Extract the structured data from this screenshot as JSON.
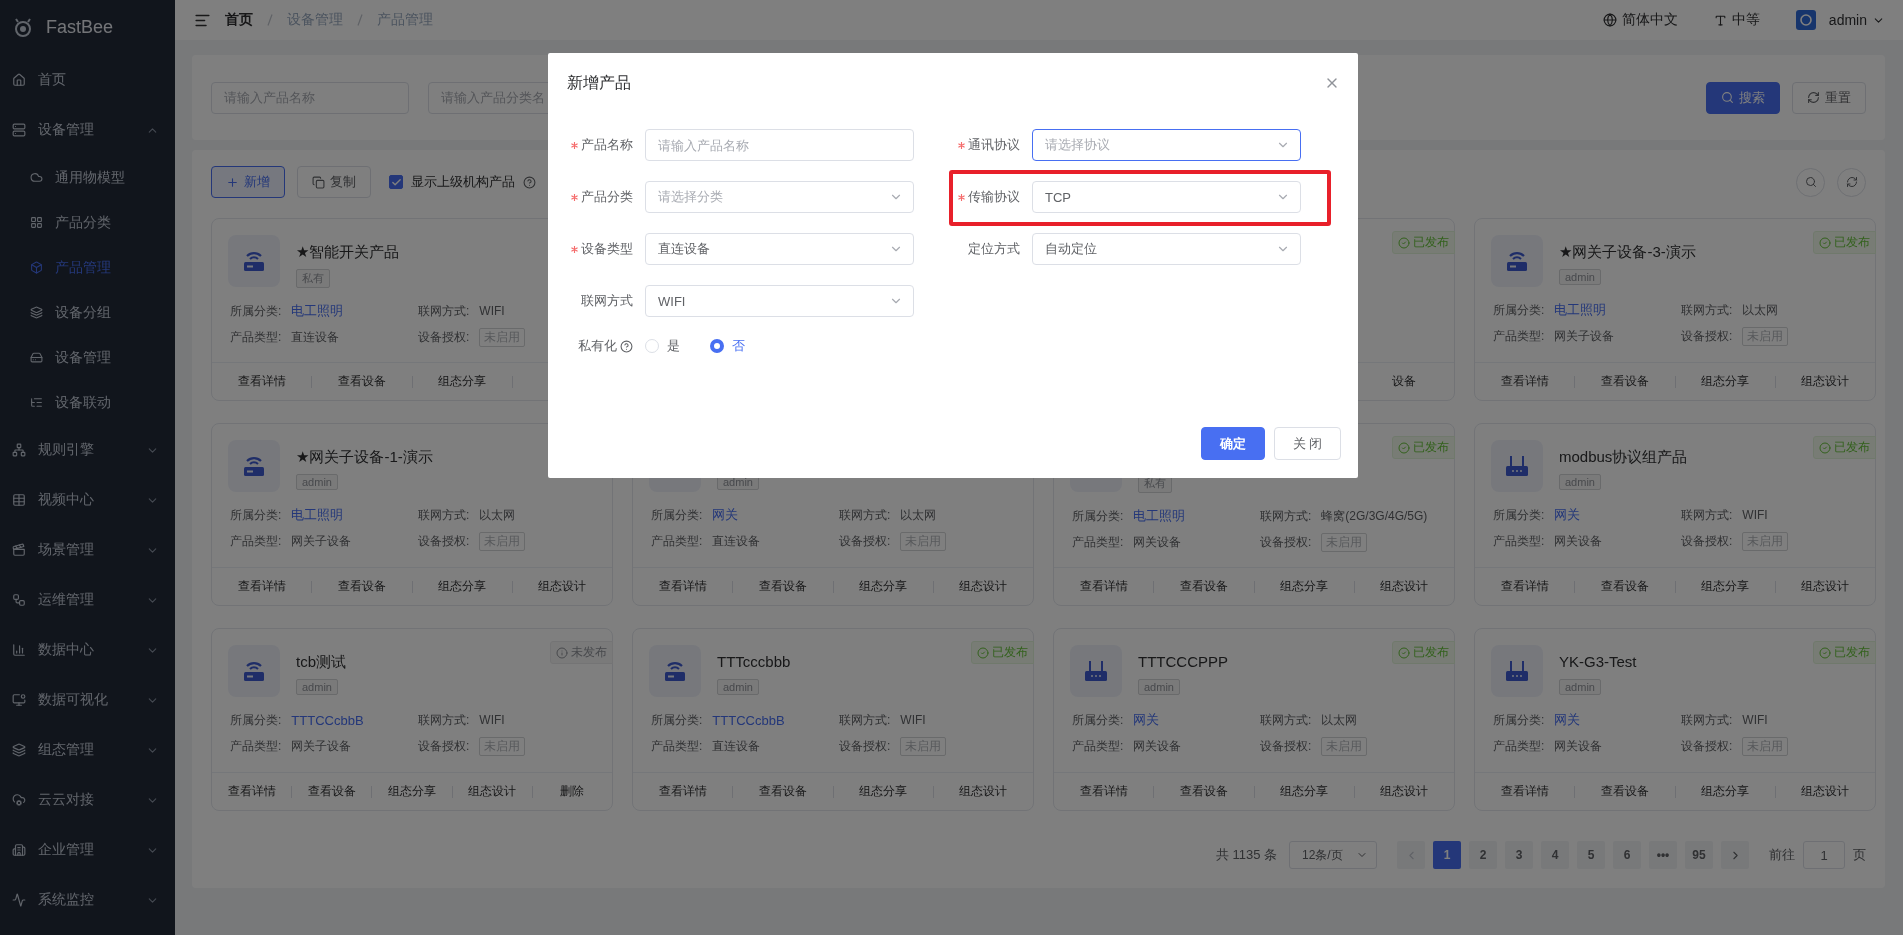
{
  "sidebar": {
    "brand": "FastBee",
    "items": [
      {
        "label": "首页",
        "selected": false
      },
      {
        "label": "设备管理",
        "selected": false,
        "expanded": true,
        "children": [
          {
            "label": "通用物模型",
            "selected": false
          },
          {
            "label": "产品分类",
            "selected": false
          },
          {
            "label": "产品管理",
            "selected": true
          },
          {
            "label": "设备分组",
            "selected": false
          },
          {
            "label": "设备管理",
            "selected": false
          },
          {
            "label": "设备联动",
            "selected": false
          }
        ]
      },
      {
        "label": "规则引擎",
        "selected": false,
        "expanded": false
      },
      {
        "label": "视频中心",
        "selected": false,
        "expanded": false
      },
      {
        "label": "场景管理",
        "selected": false,
        "expanded": false
      },
      {
        "label": "运维管理",
        "selected": false,
        "expanded": false
      },
      {
        "label": "数据中心",
        "selected": false,
        "expanded": false
      },
      {
        "label": "数据可视化",
        "selected": false,
        "expanded": false
      },
      {
        "label": "组态管理",
        "selected": false,
        "expanded": false
      },
      {
        "label": "云云对接",
        "selected": false,
        "expanded": false
      },
      {
        "label": "企业管理",
        "selected": false,
        "expanded": false
      },
      {
        "label": "系统监控",
        "selected": false,
        "expanded": false
      }
    ]
  },
  "header": {
    "breadcrumb": [
      {
        "label": "首页",
        "link": true
      },
      {
        "label": "设备管理",
        "link": false
      },
      {
        "label": "产品管理",
        "link": false
      }
    ],
    "language": "简体中文",
    "size": "中等",
    "user": "admin"
  },
  "filter": {
    "fields": [
      {
        "placeholder": "请输入产品名称"
      },
      {
        "placeholder": "请输入产品分类名"
      }
    ],
    "buttons": [
      {
        "label": "搜索",
        "kind": "primary"
      },
      {
        "label": "重置",
        "kind": "default"
      }
    ]
  },
  "toolbar": {
    "buttons": [
      {
        "label": "新增",
        "kind": "plain"
      },
      {
        "label": "复制",
        "kind": "default"
      }
    ],
    "checkbox": {
      "label": "显示上级机构产品",
      "checked": true
    }
  },
  "cards": [
    {
      "kind": "router",
      "name": "★智能开关产品",
      "tag": "私有",
      "fields": [
        {
          "label": "所属分类:",
          "value": "电工照明",
          "kind": "link"
        },
        {
          "label": "联网方式:",
          "value": "WIFI",
          "kind": "text"
        },
        {
          "label": "产品类型:",
          "value": "直连设备",
          "kind": "text"
        },
        {
          "label": "设备授权:",
          "value": "未启用",
          "kind": "tag"
        }
      ],
      "actions": [
        "查看详情",
        "查看设备",
        "组态分享"
      ]
    },
    {
      "status": {
        "label": "已发布",
        "published": true
      },
      "actions": [
        "设备"
      ]
    },
    {
      "kind": "router",
      "name": "★网关子设备-3-演示",
      "tag": "admin",
      "status": {
        "label": "已发布",
        "published": true
      },
      "fields": [
        {
          "label": "所属分类:",
          "value": "电工照明",
          "kind": "link"
        },
        {
          "label": "联网方式:",
          "value": "以太网",
          "kind": "text"
        },
        {
          "label": "产品类型:",
          "value": "网关子设备",
          "kind": "text"
        },
        {
          "label": "设备授权:",
          "value": "未启用",
          "kind": "tag"
        }
      ],
      "actions": [
        "查看详情",
        "查看设备",
        "组态分享",
        "组态设计"
      ]
    },
    {
      "kind": "router",
      "name": "★网关子设备-1-演示",
      "tag": "admin",
      "fields": [
        {
          "label": "所属分类:",
          "value": "电工照明",
          "kind": "link"
        },
        {
          "label": "联网方式:",
          "value": "以太网",
          "kind": "text"
        },
        {
          "label": "产品类型:",
          "value": "网关子设备",
          "kind": "text"
        },
        {
          "label": "设备授权:",
          "value": "未启用",
          "kind": "tag"
        }
      ],
      "actions": [
        "查看详情",
        "查看设备",
        "组态分享",
        "组态设计"
      ]
    },
    {
      "tag": "admin",
      "fields": [
        {
          "label": "所属分类:",
          "value": "网关",
          "kind": "link"
        },
        {
          "label": "联网方式:",
          "value": "以太网",
          "kind": "text"
        },
        {
          "label": "产品类型:",
          "value": "直连设备",
          "kind": "text"
        },
        {
          "label": "设备授权:",
          "value": "未启用",
          "kind": "tag"
        }
      ],
      "actions": [
        "查看详情",
        "查看设备",
        "组态分享",
        "组态设计"
      ]
    },
    {
      "tag": "私有",
      "status": {
        "label": "已发布",
        "published": true
      },
      "fields": [
        {
          "label": "所属分类:",
          "value": "电工照明",
          "kind": "link"
        },
        {
          "label": "联网方式:",
          "value": "蜂窝(2G/3G/4G/5G)",
          "kind": "text"
        },
        {
          "label": "产品类型:",
          "value": "网关设备",
          "kind": "text"
        },
        {
          "label": "设备授权:",
          "value": "未启用",
          "kind": "tag"
        }
      ],
      "actions": [
        "查看详情",
        "查看设备",
        "组态分享",
        "组态设计"
      ]
    },
    {
      "kind": "gateway",
      "name": "modbus协议组产品",
      "tag": "admin",
      "status": {
        "label": "已发布",
        "published": true
      },
      "fields": [
        {
          "label": "所属分类:",
          "value": "网关",
          "kind": "link"
        },
        {
          "label": "联网方式:",
          "value": "WIFI",
          "kind": "text"
        },
        {
          "label": "产品类型:",
          "value": "网关设备",
          "kind": "text"
        },
        {
          "label": "设备授权:",
          "value": "未启用",
          "kind": "tag"
        }
      ],
      "actions": [
        "查看详情",
        "查看设备",
        "组态分享",
        "组态设计"
      ]
    },
    {
      "kind": "router",
      "name": "tcb测试",
      "tag": "admin",
      "status": {
        "label": "未发布",
        "published": false
      },
      "fields": [
        {
          "label": "所属分类:",
          "value": "TTTCCcbbB",
          "kind": "link"
        },
        {
          "label": "联网方式:",
          "value": "WIFI",
          "kind": "text"
        },
        {
          "label": "产品类型:",
          "value": "网关子设备",
          "kind": "text"
        },
        {
          "label": "设备授权:",
          "value": "未启用",
          "kind": "tag"
        }
      ],
      "actions": [
        "查看详情",
        "查看设备",
        "组态分享",
        "组态设计",
        "删除"
      ]
    },
    {
      "kind": "router",
      "name": "TTTcccbbb",
      "tag": "admin",
      "status": {
        "label": "已发布",
        "published": true
      },
      "fields": [
        {
          "label": "所属分类:",
          "value": "TTTCCcbbB",
          "kind": "link"
        },
        {
          "label": "联网方式:",
          "value": "WIFI",
          "kind": "text"
        },
        {
          "label": "产品类型:",
          "value": "直连设备",
          "kind": "text"
        },
        {
          "label": "设备授权:",
          "value": "未启用",
          "kind": "tag"
        }
      ],
      "actions": [
        "查看详情",
        "查看设备",
        "组态分享",
        "组态设计"
      ]
    },
    {
      "kind": "gateway",
      "name": "TTTCCCPPP",
      "tag": "admin",
      "status": {
        "label": "已发布",
        "published": true
      },
      "fields": [
        {
          "label": "所属分类:",
          "value": "网关",
          "kind": "link"
        },
        {
          "label": "联网方式:",
          "value": "以太网",
          "kind": "text"
        },
        {
          "label": "产品类型:",
          "value": "网关设备",
          "kind": "text"
        },
        {
          "label": "设备授权:",
          "value": "未启用",
          "kind": "tag"
        }
      ],
      "actions": [
        "查看详情",
        "查看设备",
        "组态分享",
        "组态设计"
      ]
    },
    {
      "kind": "gateway",
      "name": "YK-G3-Test",
      "tag": "admin",
      "status": {
        "label": "已发布",
        "published": true
      },
      "fields": [
        {
          "label": "所属分类:",
          "value": "网关",
          "kind": "link"
        },
        {
          "label": "联网方式:",
          "value": "WIFI",
          "kind": "text"
        },
        {
          "label": "产品类型:",
          "value": "网关设备",
          "kind": "text"
        },
        {
          "label": "设备授权:",
          "value": "未启用",
          "kind": "tag"
        }
      ],
      "actions": [
        "查看详情",
        "查看设备",
        "组态分享",
        "组态设计"
      ]
    }
  ],
  "pagination": {
    "total": "共 1135 条",
    "page_size": "12条/页",
    "pages": [
      {
        "label": "1",
        "selected": true
      },
      {
        "label": "2",
        "selected": false
      },
      {
        "label": "3",
        "selected": false
      },
      {
        "label": "4",
        "selected": false
      },
      {
        "label": "5",
        "selected": false
      },
      {
        "label": "6",
        "selected": false
      },
      {
        "label": "•••",
        "selected": false
      },
      {
        "label": "95",
        "selected": false
      }
    ],
    "jump_label": "前往",
    "jump_value": "1",
    "jump_unit": "页"
  },
  "dialog": {
    "title": "新增产品",
    "fields": [
      {
        "label": "产品名称",
        "required": true,
        "kind": "input",
        "placeholder": "请输入产品名称",
        "focused": false,
        "highlighted": false
      },
      {
        "label": "通讯协议",
        "required": true,
        "kind": "select",
        "placeholder": "请选择协议",
        "focused": true,
        "highlighted": false
      },
      {
        "label": "产品分类",
        "required": true,
        "kind": "select",
        "placeholder": "请选择分类",
        "focused": false,
        "highlighted": false
      },
      {
        "label": "传输协议",
        "required": true,
        "kind": "select",
        "value": "TCP",
        "focused": false,
        "highlighted": true
      },
      {
        "label": "设备类型",
        "required": true,
        "kind": "select",
        "value": "直连设备",
        "focused": false,
        "highlighted": false
      },
      {
        "label": "定位方式",
        "required": false,
        "kind": "select",
        "value": "自动定位",
        "focused": false,
        "highlighted": false
      },
      {
        "label": "联网方式",
        "required": false,
        "kind": "select",
        "value": "WIFI",
        "focused": false,
        "highlighted": false
      }
    ],
    "privacy": {
      "label": "私有化",
      "options": [
        {
          "label": "是",
          "selected": false
        },
        {
          "label": "否",
          "selected": true
        }
      ]
    },
    "buttons": [
      {
        "label": "确定",
        "kind": "primary"
      },
      {
        "label": "关 闭",
        "kind": "default"
      }
    ]
  }
}
